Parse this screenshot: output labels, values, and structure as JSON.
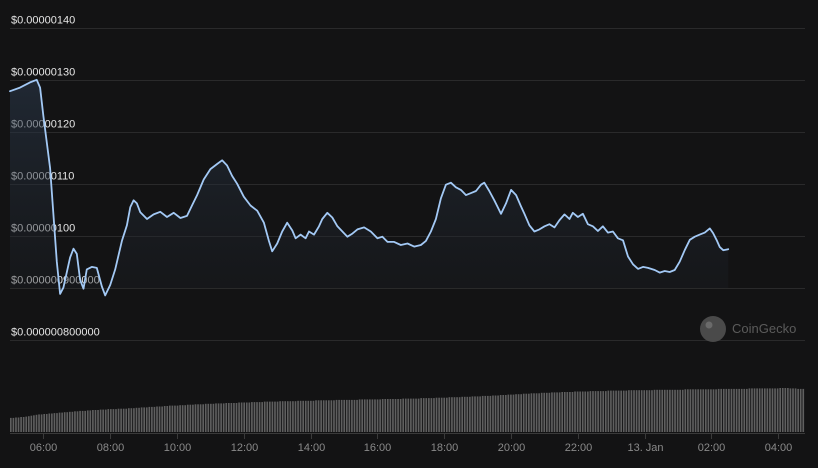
{
  "chart_data": {
    "type": "line",
    "y_tick_labels": [
      "$0.00000140",
      "$0.00000130",
      "$0.00000120",
      "$0.00000110",
      "$0.00000100",
      "$0.000000900000",
      "$0.000000800000"
    ],
    "y_ticks": [
      1.4e-06,
      1.3e-06,
      1.2e-06,
      1.1e-06,
      1e-06,
      9e-07,
      8e-07
    ],
    "ylim": [
      7.8e-07,
      1.415e-06
    ],
    "x_tick_labels": [
      "06:00",
      "08:00",
      "10:00",
      "12:00",
      "14:00",
      "16:00",
      "18:00",
      "20:00",
      "22:00",
      "13. Jan",
      "02:00",
      "04:00"
    ],
    "x_ticks": [
      1,
      3,
      5,
      7,
      9,
      11,
      13,
      15,
      17,
      19,
      21,
      23
    ],
    "x_unit": "hours since 05:00 on 12 Jan",
    "xlim": [
      0,
      23.8
    ],
    "grid": true,
    "line_color": "#a3c9f5",
    "series": [
      {
        "values": [
          [
            0.0,
            1.278e-06
          ],
          [
            0.3,
            1.285e-06
          ],
          [
            0.6,
            1.295e-06
          ],
          [
            0.8,
            1.3e-06
          ],
          [
            0.9,
            1.285e-06
          ],
          [
            1.0,
            1.23e-06
          ],
          [
            1.2,
            1.13e-06
          ],
          [
            1.4,
            9.5e-07
          ],
          [
            1.5,
            8.88e-07
          ],
          [
            1.6,
            9e-07
          ],
          [
            1.8,
            9.58e-07
          ],
          [
            1.9,
            9.75e-07
          ],
          [
            2.0,
            9.65e-07
          ],
          [
            2.1,
            9.15e-07
          ],
          [
            2.2,
            8.98e-07
          ],
          [
            2.3,
            9.35e-07
          ],
          [
            2.45,
            9.4e-07
          ],
          [
            2.6,
            9.38e-07
          ],
          [
            2.75,
            9.02e-07
          ],
          [
            2.85,
            8.85e-07
          ],
          [
            3.0,
            9.05e-07
          ],
          [
            3.15,
            9.35e-07
          ],
          [
            3.35,
            9.9e-07
          ],
          [
            3.5,
            1.02e-06
          ],
          [
            3.6,
            1.055e-06
          ],
          [
            3.7,
            1.068e-06
          ],
          [
            3.8,
            1.062e-06
          ],
          [
            3.9,
            1.045e-06
          ],
          [
            4.1,
            1.032e-06
          ],
          [
            4.3,
            1.041e-06
          ],
          [
            4.5,
            1.046e-06
          ],
          [
            4.7,
            1.036e-06
          ],
          [
            4.9,
            1.044e-06
          ],
          [
            5.1,
            1.034e-06
          ],
          [
            5.3,
            1.038e-06
          ],
          [
            5.45,
            1.058e-06
          ],
          [
            5.6,
            1.078e-06
          ],
          [
            5.8,
            1.108e-06
          ],
          [
            6.0,
            1.128e-06
          ],
          [
            6.2,
            1.138e-06
          ],
          [
            6.35,
            1.145e-06
          ],
          [
            6.5,
            1.135e-06
          ],
          [
            6.65,
            1.115e-06
          ],
          [
            6.8,
            1.1e-06
          ],
          [
            7.0,
            1.075e-06
          ],
          [
            7.2,
            1.058e-06
          ],
          [
            7.4,
            1.048e-06
          ],
          [
            7.6,
            1.025e-06
          ],
          [
            7.75,
            9.9e-07
          ],
          [
            7.85,
            9.7e-07
          ],
          [
            8.0,
            9.85e-07
          ],
          [
            8.15,
            1.008e-06
          ],
          [
            8.3,
            1.025e-06
          ],
          [
            8.45,
            1.01e-06
          ],
          [
            8.55,
            9.95e-07
          ],
          [
            8.7,
            1.002e-06
          ],
          [
            8.85,
            9.95e-07
          ],
          [
            8.95,
            1.008e-06
          ],
          [
            9.1,
            1.002e-06
          ],
          [
            9.25,
            1.018e-06
          ],
          [
            9.35,
            1.032e-06
          ],
          [
            9.5,
            1.044e-06
          ],
          [
            9.65,
            1.035e-06
          ],
          [
            9.8,
            1.018e-06
          ],
          [
            9.95,
            1.008e-06
          ],
          [
            10.1,
            9.98e-07
          ],
          [
            10.25,
            1.004e-06
          ],
          [
            10.4,
            1.012e-06
          ],
          [
            10.6,
            1.016e-06
          ],
          [
            10.8,
            1.008e-06
          ],
          [
            11.0,
            9.95e-07
          ],
          [
            11.15,
            9.98e-07
          ],
          [
            11.3,
            9.88e-07
          ],
          [
            11.5,
            9.88e-07
          ],
          [
            11.7,
            9.82e-07
          ],
          [
            11.9,
            9.85e-07
          ],
          [
            12.1,
            9.79e-07
          ],
          [
            12.3,
            9.82e-07
          ],
          [
            12.45,
            9.9e-07
          ],
          [
            12.6,
            1.008e-06
          ],
          [
            12.75,
            1.032e-06
          ],
          [
            12.9,
            1.072e-06
          ],
          [
            13.05,
            1.098e-06
          ],
          [
            13.2,
            1.102e-06
          ],
          [
            13.35,
            1.093e-06
          ],
          [
            13.5,
            1.088e-06
          ],
          [
            13.65,
            1.078e-06
          ],
          [
            13.8,
            1.082e-06
          ],
          [
            13.95,
            1.086e-06
          ],
          [
            14.1,
            1.098e-06
          ],
          [
            14.2,
            1.102e-06
          ],
          [
            14.35,
            1.086e-06
          ],
          [
            14.5,
            1.068e-06
          ],
          [
            14.6,
            1.055e-06
          ],
          [
            14.7,
            1.042e-06
          ],
          [
            14.85,
            1.062e-06
          ],
          [
            15.0,
            1.088e-06
          ],
          [
            15.15,
            1.078e-06
          ],
          [
            15.3,
            1.056e-06
          ],
          [
            15.4,
            1.042e-06
          ],
          [
            15.55,
            1.02e-06
          ],
          [
            15.7,
            1.008e-06
          ],
          [
            15.85,
            1.012e-06
          ],
          [
            16.0,
            1.018e-06
          ],
          [
            16.15,
            1.022e-06
          ],
          [
            16.3,
            1.016e-06
          ],
          [
            16.45,
            1.03e-06
          ],
          [
            16.6,
            1.041e-06
          ],
          [
            16.75,
            1.032e-06
          ],
          [
            16.85,
            1.044e-06
          ],
          [
            17.0,
            1.036e-06
          ],
          [
            17.15,
            1.042e-06
          ],
          [
            17.3,
            1.022e-06
          ],
          [
            17.45,
            1.018e-06
          ],
          [
            17.6,
            1.009e-06
          ],
          [
            17.75,
            1.018e-06
          ],
          [
            17.9,
            1.006e-06
          ],
          [
            18.05,
            1.008e-06
          ],
          [
            18.2,
            9.95e-07
          ],
          [
            18.35,
            9.91e-07
          ],
          [
            18.5,
            9.6e-07
          ],
          [
            18.65,
            9.45e-07
          ],
          [
            18.8,
            9.36e-07
          ],
          [
            18.95,
            9.4e-07
          ],
          [
            19.1,
            9.38e-07
          ],
          [
            19.3,
            9.34e-07
          ],
          [
            19.45,
            9.29e-07
          ],
          [
            19.6,
            9.32e-07
          ],
          [
            19.75,
            9.3e-07
          ],
          [
            19.9,
            9.34e-07
          ],
          [
            20.05,
            9.5e-07
          ],
          [
            20.2,
            9.72e-07
          ],
          [
            20.35,
            9.92e-07
          ],
          [
            20.5,
            9.98e-07
          ],
          [
            20.65,
            1.002e-06
          ],
          [
            20.8,
            1.006e-06
          ],
          [
            20.95,
            1.014e-06
          ],
          [
            21.05,
            1.005e-06
          ],
          [
            21.15,
            9.92e-07
          ],
          [
            21.25,
            9.78e-07
          ],
          [
            21.35,
            9.72e-07
          ],
          [
            21.5,
            9.74e-07
          ]
        ]
      }
    ],
    "volume": [
      0.32,
      0.32,
      0.33,
      0.33,
      0.34,
      0.34,
      0.35,
      0.36,
      0.37,
      0.38,
      0.39,
      0.4,
      0.4,
      0.41,
      0.41,
      0.42,
      0.42,
      0.43,
      0.43,
      0.44,
      0.44,
      0.45,
      0.45,
      0.46,
      0.46,
      0.47,
      0.47,
      0.48,
      0.48,
      0.48,
      0.49,
      0.49,
      0.5,
      0.5,
      0.5,
      0.51,
      0.51,
      0.51,
      0.52,
      0.52,
      0.52,
      0.52,
      0.53,
      0.53,
      0.53,
      0.53,
      0.54,
      0.54,
      0.54,
      0.55,
      0.55,
      0.56,
      0.56,
      0.56,
      0.57,
      0.57,
      0.57,
      0.58,
      0.58,
      0.58,
      0.59,
      0.59,
      0.6,
      0.6,
      0.6,
      0.6,
      0.61,
      0.61,
      0.61,
      0.62,
      0.62,
      0.62,
      0.63,
      0.63,
      0.63,
      0.63,
      0.64,
      0.64,
      0.64,
      0.64,
      0.65,
      0.65,
      0.65,
      0.65,
      0.66,
      0.66,
      0.66,
      0.66,
      0.66,
      0.67,
      0.67,
      0.67,
      0.67,
      0.67,
      0.68,
      0.68,
      0.68,
      0.68,
      0.68,
      0.69,
      0.69,
      0.69,
      0.69,
      0.69,
      0.69,
      0.7,
      0.7,
      0.7,
      0.7,
      0.7,
      0.7,
      0.7,
      0.71,
      0.71,
      0.71,
      0.71,
      0.71,
      0.71,
      0.71,
      0.72,
      0.72,
      0.72,
      0.72,
      0.72,
      0.72,
      0.72,
      0.72,
      0.73,
      0.73,
      0.73,
      0.73,
      0.73,
      0.73,
      0.73,
      0.73,
      0.73,
      0.74,
      0.74,
      0.74,
      0.74,
      0.74,
      0.74,
      0.74,
      0.74,
      0.74,
      0.75,
      0.75,
      0.75,
      0.75,
      0.75,
      0.75,
      0.75,
      0.75,
      0.76,
      0.76,
      0.76,
      0.76,
      0.76,
      0.76,
      0.76,
      0.77,
      0.77,
      0.77,
      0.77,
      0.77,
      0.77,
      0.78,
      0.78,
      0.78,
      0.78,
      0.78,
      0.79,
      0.79,
      0.79,
      0.79,
      0.79,
      0.8,
      0.8,
      0.8,
      0.8,
      0.81,
      0.81,
      0.81,
      0.81,
      0.82,
      0.82,
      0.82,
      0.82,
      0.83,
      0.83,
      0.83,
      0.84,
      0.84,
      0.84,
      0.85,
      0.85,
      0.85,
      0.86,
      0.86,
      0.86,
      0.87,
      0.87,
      0.87,
      0.88,
      0.88,
      0.88,
      0.88,
      0.89,
      0.89,
      0.89,
      0.89,
      0.9,
      0.9,
      0.9,
      0.9,
      0.91,
      0.91,
      0.91,
      0.91,
      0.91,
      0.92,
      0.92,
      0.92,
      0.92,
      0.92,
      0.92,
      0.93,
      0.93,
      0.93,
      0.93,
      0.93,
      0.93,
      0.93,
      0.94,
      0.94,
      0.94,
      0.94,
      0.94,
      0.94,
      0.94,
      0.94,
      0.95,
      0.95,
      0.95,
      0.95,
      0.95,
      0.95,
      0.95,
      0.95,
      0.95,
      0.95,
      0.96,
      0.96,
      0.96,
      0.96,
      0.96,
      0.96,
      0.96,
      0.96,
      0.96,
      0.96,
      0.96,
      0.96,
      0.97,
      0.97,
      0.97,
      0.97,
      0.97,
      0.97,
      0.97,
      0.97,
      0.97,
      0.97,
      0.97,
      0.97,
      0.97,
      0.98,
      0.98,
      0.98,
      0.98,
      0.98,
      0.98,
      0.98,
      0.98,
      0.98,
      0.98,
      0.98,
      0.98,
      0.99,
      0.99,
      0.99,
      0.99,
      0.99,
      0.99,
      0.99,
      0.99,
      0.99,
      0.99,
      0.99,
      0.99,
      1.0,
      1.0,
      1.0,
      1.0,
      0.99,
      0.99,
      0.99,
      0.98,
      0.98,
      0.98
    ]
  },
  "watermark": {
    "text": "CoinGecko",
    "icon": "coingecko-logo-icon"
  }
}
